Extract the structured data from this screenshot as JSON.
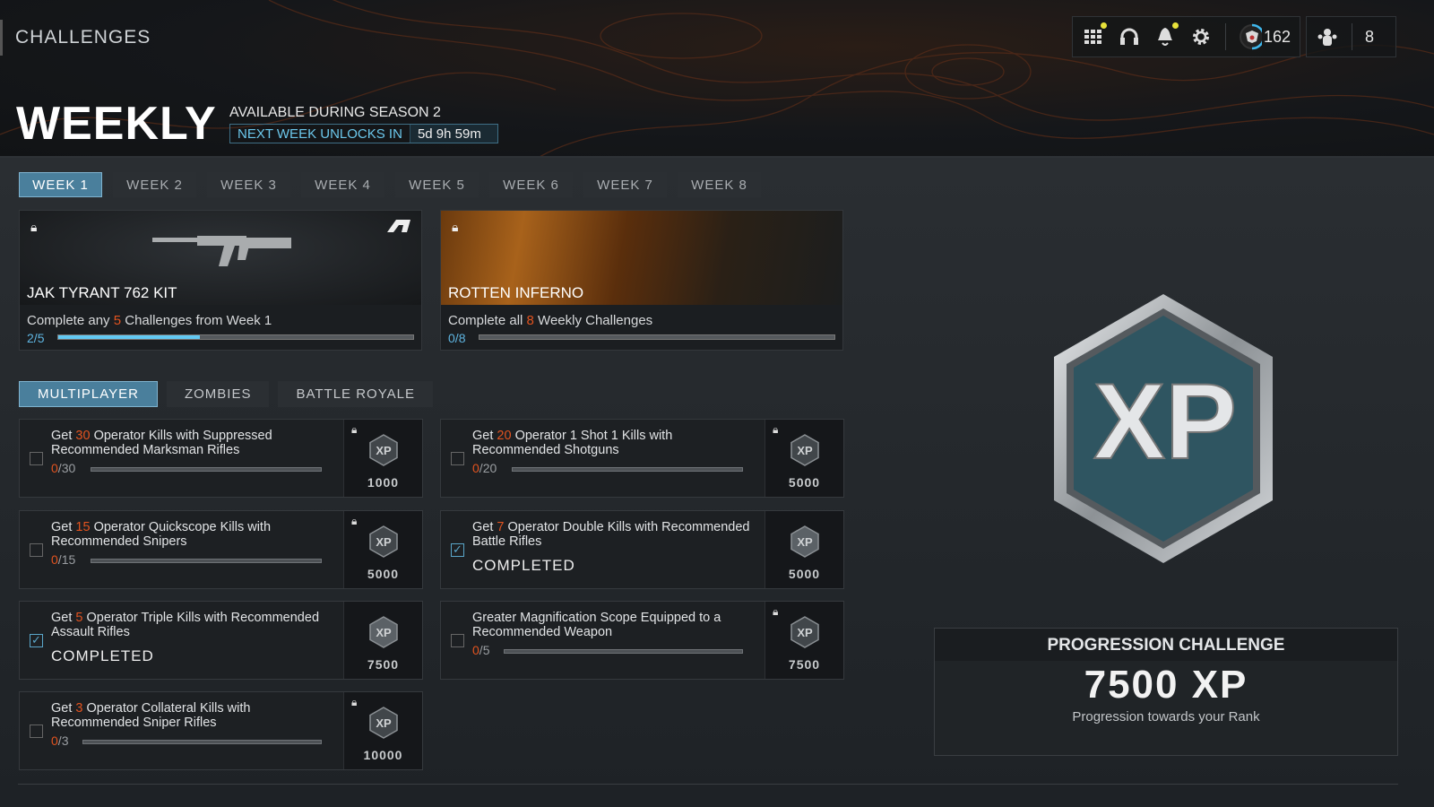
{
  "header": {
    "title": "CHALLENGES",
    "level": "162",
    "party_count": "8",
    "icons": [
      "grid-menu-icon",
      "headset-icon",
      "bell-icon",
      "gear-icon",
      "player-emblem-icon",
      "party-icon"
    ]
  },
  "weekly": {
    "title": "WEEKLY",
    "availability": "AVAILABLE DURING SEASON 2",
    "unlock_label": "NEXT WEEK UNLOCKS IN",
    "unlock_time": "5d 9h 59m"
  },
  "week_tabs": [
    "WEEK 1",
    "WEEK 2",
    "WEEK 3",
    "WEEK 4",
    "WEEK 5",
    "WEEK 6",
    "WEEK 7",
    "WEEK 8"
  ],
  "active_week": 0,
  "rewards": [
    {
      "name": "JAK TYRANT 762 KIT",
      "desc_pre": "Complete any ",
      "desc_num": "5",
      "desc_post": " Challenges from Week 1",
      "current": "2",
      "total": "5",
      "progress": 0.4
    },
    {
      "name": "ROTTEN INFERNO",
      "desc_pre": "Complete all ",
      "desc_num": "8",
      "desc_post": " Weekly Challenges",
      "current": "0",
      "total": "8",
      "progress": 0
    }
  ],
  "mode_tabs": [
    "MULTIPLAYER",
    "ZOMBIES",
    "BATTLE ROYALE"
  ],
  "completed_label": "COMPLETED",
  "challenges": [
    {
      "pre": "Get ",
      "num": "30",
      "post": " Operator Kills with Suppressed Recommended Marksman Rifles",
      "current": "0",
      "total": "30",
      "xp": "1000",
      "completed": false,
      "locked": true
    },
    {
      "pre": "Get ",
      "num": "20",
      "post": " Operator 1 Shot 1 Kills with Recommended Shotguns",
      "current": "0",
      "total": "20",
      "xp": "5000",
      "completed": false,
      "locked": true
    },
    {
      "pre": "Get ",
      "num": "15",
      "post": " Operator Quickscope Kills with Recommended Snipers",
      "current": "0",
      "total": "15",
      "xp": "5000",
      "completed": false,
      "locked": true
    },
    {
      "pre": "Get ",
      "num": "7",
      "post": " Operator Double Kills with Recommended Battle Rifles",
      "current": "7",
      "total": "7",
      "xp": "5000",
      "completed": true,
      "locked": false
    },
    {
      "pre": "Get ",
      "num": "5",
      "post": " Operator Triple Kills with Recommended Assault Rifles",
      "current": "5",
      "total": "5",
      "xp": "7500",
      "completed": true,
      "locked": false
    },
    {
      "pre": "",
      "num": "",
      "post": "Greater Magnification Scope Equipped to a Recommended Weapon",
      "current": "0",
      "total": "5",
      "xp": "7500",
      "completed": false,
      "locked": true
    },
    {
      "pre": "Get ",
      "num": "3",
      "post": " Operator Collateral Kills with Recommended Sniper Rifles",
      "current": "0",
      "total": "3",
      "xp": "10000",
      "completed": false,
      "locked": true
    }
  ],
  "progression": {
    "title": "PROGRESSION CHALLENGE",
    "value": "7500 XP",
    "subtitle": "Progression towards your Rank",
    "badge_text": "XP"
  },
  "colors": {
    "accent": "#4a7f9c",
    "highlight": "#e2531f",
    "progress": "#62c9f3"
  }
}
